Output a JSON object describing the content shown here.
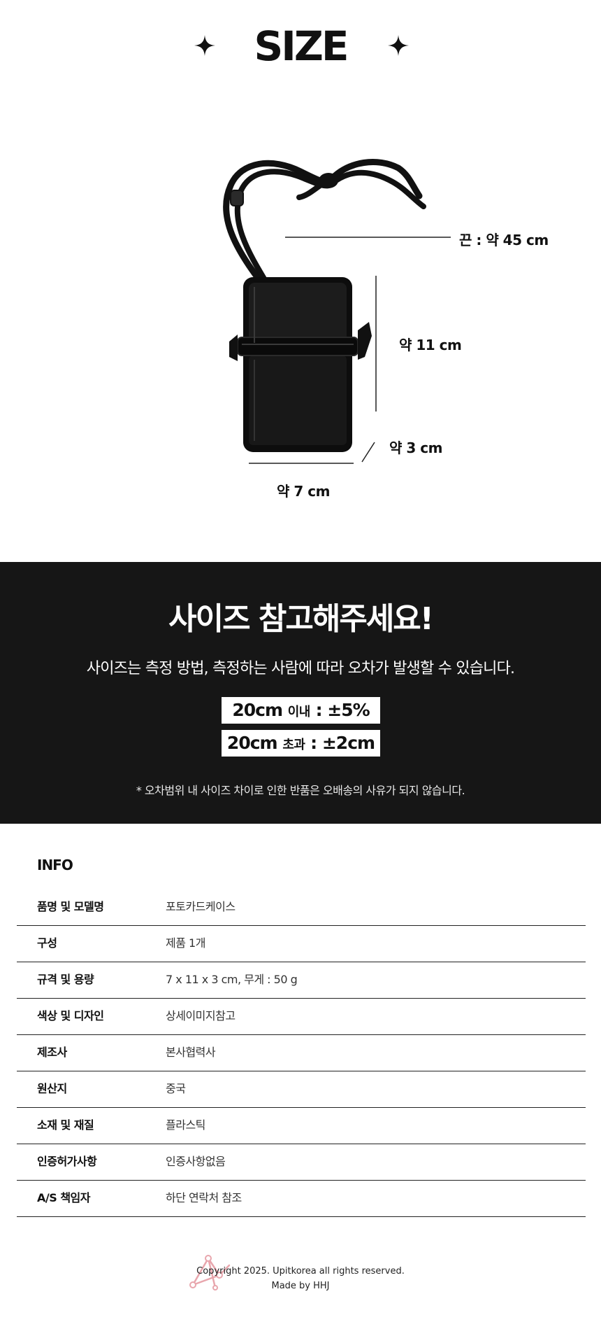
{
  "size_section": {
    "title": "SIZE",
    "dimensions": {
      "strap": "끈 : 약 45 cm",
      "height": "약 11 cm",
      "depth": "약 3 cm",
      "width": "약 7 cm"
    }
  },
  "notice": {
    "title": "사이즈 참고해주세요!",
    "subtitle": "사이즈는 측정 방법, 측정하는 사람에 따라 오차가 발생할 수 있습니다.",
    "tolerances": [
      {
        "size": "20cm",
        "condition": "이내",
        "tolerance": ": ±5%"
      },
      {
        "size": "20cm",
        "condition": "초과",
        "tolerance": ": ±2cm"
      }
    ],
    "footnote": "* 오차범위 내 사이즈 차이로 인한 반품은 오배송의 사유가 되지 않습니다."
  },
  "info": {
    "title": "INFO",
    "rows": [
      {
        "key": "품명 및 모델명",
        "value": "포토카드케이스"
      },
      {
        "key": "구성",
        "value": "제품 1개"
      },
      {
        "key": "규격 및 용량",
        "value": "7 x 11 x 3 cm, 무게 : 50 g"
      },
      {
        "key": "색상 및 디자인",
        "value": "상세이미지참고"
      },
      {
        "key": "제조사",
        "value": "본사협력사"
      },
      {
        "key": "원산지",
        "value": "중국"
      },
      {
        "key": "소재 및 재질",
        "value": "플라스틱"
      },
      {
        "key": "인증허가사항",
        "value": "인증사항없음"
      },
      {
        "key": "A/S 책임자",
        "value": "하단 연락처 참조"
      }
    ]
  },
  "footer": {
    "copyright": "Copyright 2025. Upitkorea all rights reserved.",
    "made_by": "Made by HHJ",
    "logo_color": "#e8a6ad"
  },
  "colors": {
    "dark_panel": "#161616",
    "text": "#111111"
  }
}
